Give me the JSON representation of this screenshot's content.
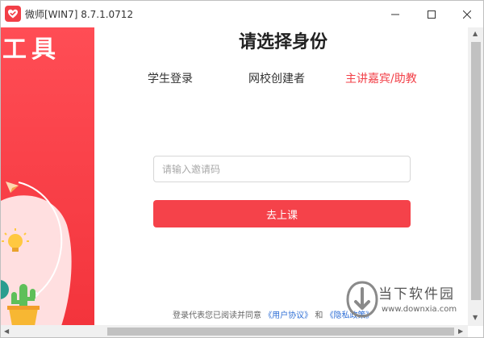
{
  "window": {
    "title": "微师[WIN7] 8.7.1.0712",
    "controls": {
      "minimize_glyph": "—",
      "maximize_glyph": "☐",
      "close_glyph": "✕"
    }
  },
  "banner": {
    "text": "工具",
    "background": "#f23f47"
  },
  "main": {
    "title": "请选择身份",
    "tabs": [
      {
        "label": "学生登录",
        "active": false
      },
      {
        "label": "网校创建者",
        "active": false
      },
      {
        "label": "主讲嘉宾/助教",
        "active": true
      }
    ],
    "invite_input": {
      "placeholder": "请输入邀请码",
      "value": ""
    },
    "submit_button": {
      "label": "去上课"
    },
    "agreement": {
      "prefix": "登录代表您已阅读并同意",
      "user_agreement": "《用户协议》",
      "conjunction": "和",
      "privacy_policy": "《隐私政策》"
    }
  },
  "watermark": {
    "name": "当下软件园",
    "url": "www.downxia.com"
  },
  "colors": {
    "accent": "#f23f47",
    "link": "#2f6fd6"
  },
  "icons": {
    "app_logo": "heart-check-icon",
    "banner_illustration": [
      "paper-plane-icon",
      "lightbulb-icon",
      "cactus-icon"
    ]
  }
}
